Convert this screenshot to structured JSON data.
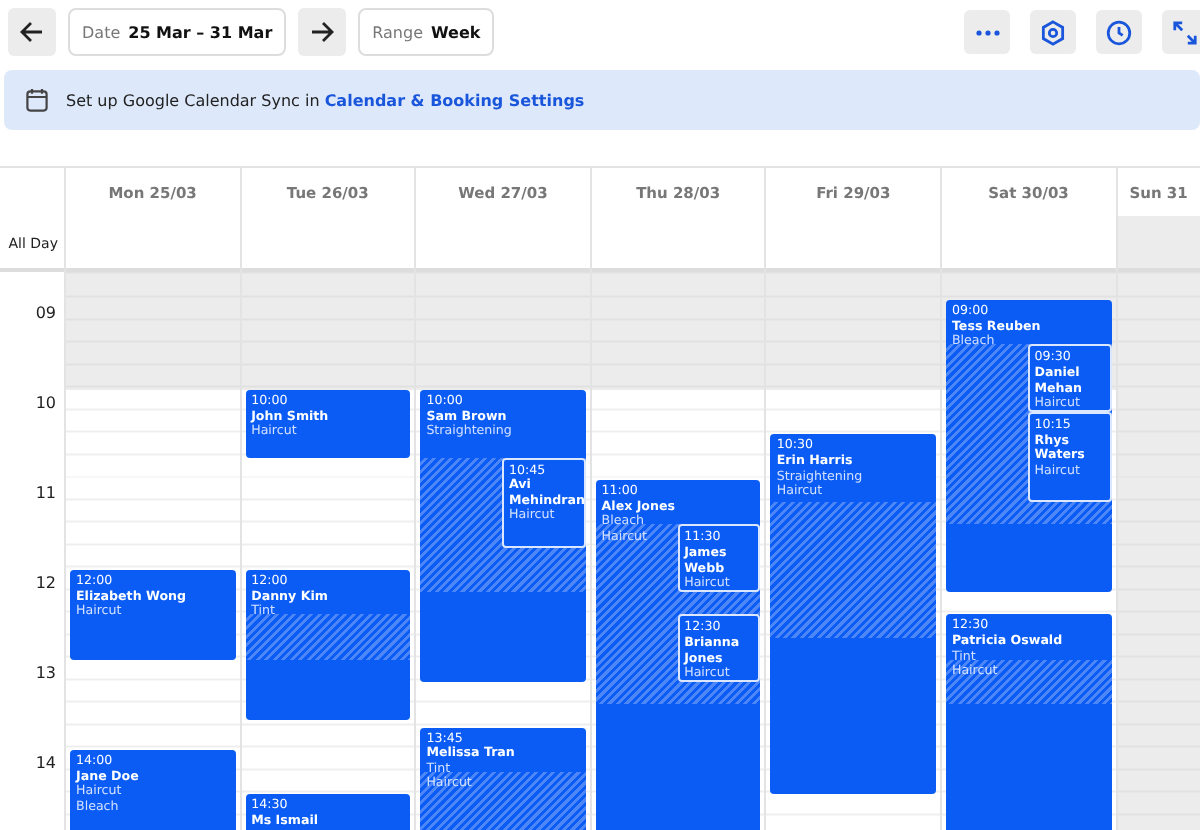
{
  "toolbar": {
    "date": {
      "label": "Date",
      "value": "25 Mar – 31 Mar"
    },
    "range": {
      "label": "Range",
      "value": "Week"
    }
  },
  "banner": {
    "text": "Set up Google Calendar Sync in ",
    "link": "Calendar & Booking Settings"
  },
  "calendar": {
    "all_day_label": "All Day",
    "hours": [
      "09",
      "10",
      "11",
      "12",
      "13",
      "14"
    ],
    "days": [
      {
        "label": "Mon 25/03",
        "closed": false,
        "events": [
          {
            "start": "12:00",
            "name": "Elizabeth Wong",
            "services": [
              "Haircut"
            ]
          },
          {
            "start": "14:00",
            "name": "Jane Doe",
            "services": [
              "Haircut",
              "Bleach"
            ]
          }
        ]
      },
      {
        "label": "Tue 26/03",
        "closed": false,
        "events": [
          {
            "start": "10:00",
            "name": "John Smith",
            "services": [
              "Haircut"
            ]
          },
          {
            "start": "12:00",
            "name": "Danny Kim",
            "services": [
              "Tint"
            ]
          },
          {
            "start": "14:30",
            "name": "Ms Ismail"
          }
        ]
      },
      {
        "label": "Wed 27/03",
        "closed": false,
        "events": [
          {
            "start": "10:00",
            "name": "Sam Brown",
            "services": [
              "Straightening"
            ],
            "overlaps": [
              {
                "start": "10:45",
                "name": "Avi Mehindran",
                "services": [
                  "Haircut"
                ]
              }
            ]
          },
          {
            "start": "13:45",
            "name": "Melissa Tran",
            "services": [
              "Tint",
              "Haircut"
            ]
          }
        ]
      },
      {
        "label": "Thu 28/03",
        "closed": false,
        "events": [
          {
            "start": "11:00",
            "name": "Alex Jones",
            "services": [
              "Bleach",
              "Haircut"
            ],
            "overlaps": [
              {
                "start": "11:30",
                "name": "James Webb",
                "services": [
                  "Haircut"
                ]
              },
              {
                "start": "12:30",
                "name": "Brianna Jones",
                "services": [
                  "Haircut"
                ]
              }
            ]
          }
        ]
      },
      {
        "label": "Fri 29/03",
        "closed": false,
        "events": [
          {
            "start": "10:30",
            "name": "Erin Harris",
            "services": [
              "Straightening",
              "Haircut"
            ]
          }
        ]
      },
      {
        "label": "Sat 30/03",
        "closed": false,
        "events": [
          {
            "start": "09:00",
            "name": "Tess Reuben",
            "services": [
              "Bleach"
            ],
            "overlaps": [
              {
                "start": "09:30",
                "name": "Daniel Mehan",
                "services": [
                  "Haircut"
                ]
              },
              {
                "start": "10:15",
                "name": "Rhys Waters",
                "services": [
                  "Haircut"
                ]
              }
            ]
          },
          {
            "start": "12:30",
            "name": "Patricia Oswald",
            "services": [
              "Tint",
              "Haircut"
            ]
          }
        ]
      },
      {
        "label": "Sun 31",
        "closed": true
      }
    ]
  }
}
